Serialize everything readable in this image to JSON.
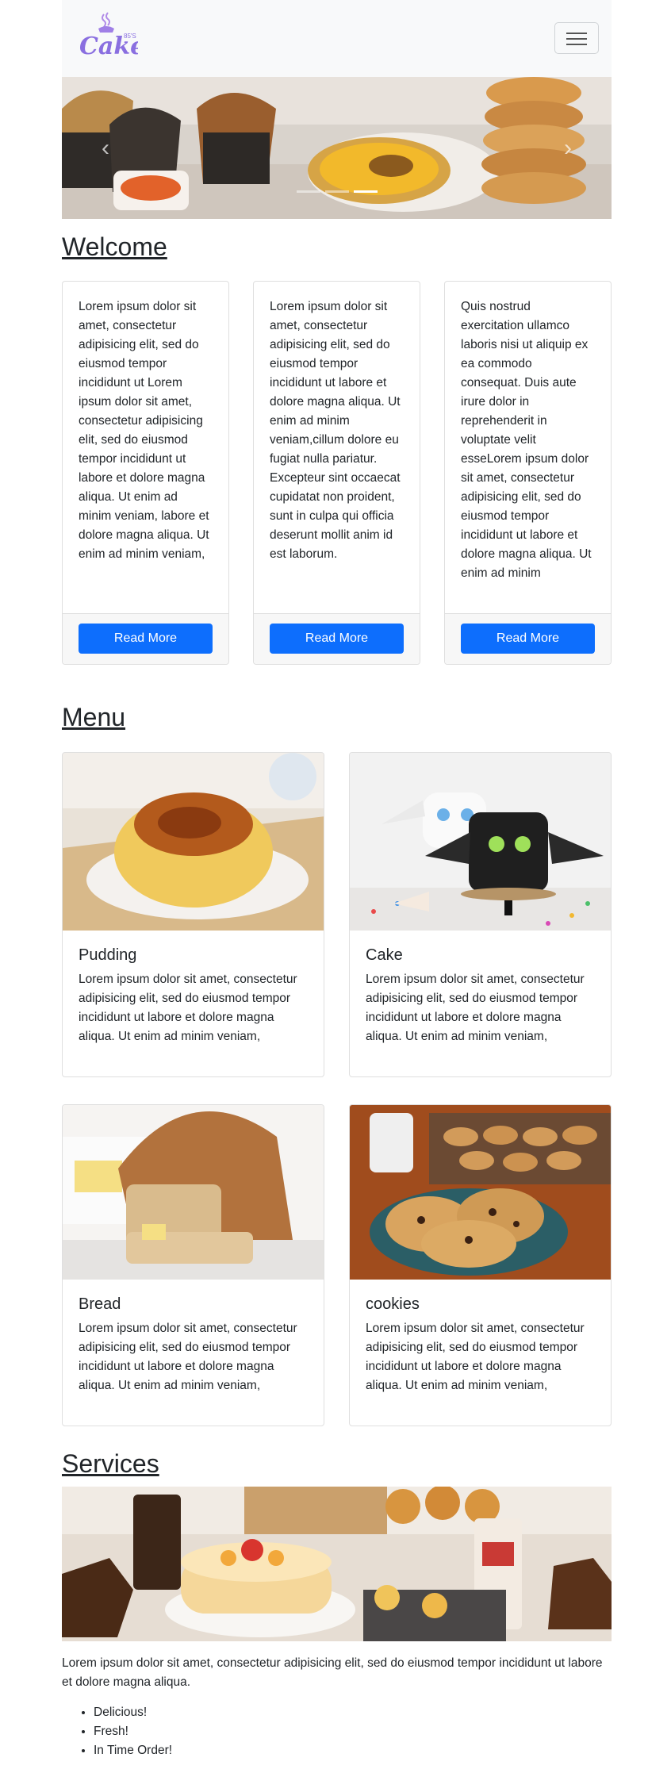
{
  "navbar": {
    "logo_text": "Cakes",
    "logo_superscript": "85'S",
    "toggler_icon": "hamburger-icon"
  },
  "carousel": {
    "prev_icon": "chevron-left-icon",
    "next_icon": "chevron-right-icon",
    "slides": 3,
    "active_slide": 3
  },
  "welcome": {
    "heading": "Welcome",
    "cards": [
      {
        "text": "Lorem ipsum dolor sit amet, consectetur adipisicing elit, sed do eiusmod tempor incididunt ut Lorem ipsum dolor sit amet, consectetur adipisicing elit, sed do eiusmod tempor incididunt ut labore et dolore magna aliqua. Ut enim ad minim veniam, labore et dolore magna aliqua. Ut enim ad minim veniam,",
        "button": "Read More"
      },
      {
        "text": "Lorem ipsum dolor sit amet, consectetur adipisicing elit, sed do eiusmod tempor incididunt ut labore et dolore magna aliqua. Ut enim ad minim veniam,cillum dolore eu fugiat nulla pariatur. Excepteur sint occaecat cupidatat non proident, sunt in culpa qui officia deserunt mollit anim id est laborum.",
        "button": "Read More"
      },
      {
        "text": "Quis nostrud exercitation ullamco laboris nisi ut aliquip ex ea commodo consequat. Duis aute irure dolor in reprehenderit in voluptate velit esseLorem ipsum dolor sit amet, consectetur adipisicing elit, sed do eiusmod tempor incididunt ut labore et dolore magna aliqua. Ut enim ad minim",
        "button": "Read More"
      }
    ]
  },
  "menu": {
    "heading": "Menu",
    "items": [
      {
        "title": "Pudding",
        "text": "Lorem ipsum dolor sit amet, consectetur adipisicing elit, sed do eiusmod tempor incididunt ut labore et dolore magna aliqua. Ut enim ad minim veniam,"
      },
      {
        "title": "Cake",
        "text": "Lorem ipsum dolor sit amet, consectetur adipisicing elit, sed do eiusmod tempor incididunt ut labore et dolore magna aliqua. Ut enim ad minim veniam,"
      },
      {
        "title": "Bread",
        "text": "Lorem ipsum dolor sit amet, consectetur adipisicing elit, sed do eiusmod tempor incididunt ut labore et dolore magna aliqua. Ut enim ad minim veniam,"
      },
      {
        "title": "cookies",
        "text": "Lorem ipsum dolor sit amet, consectetur adipisicing elit, sed do eiusmod tempor incididunt ut labore et dolore magna aliqua. Ut enim ad minim veniam,"
      }
    ]
  },
  "services": {
    "heading": "Services",
    "text": "Lorem ipsum dolor sit amet, consectetur adipisicing elit, sed do eiusmod tempor incididunt ut labore et dolore magna aliqua.",
    "list": [
      "Delicious!",
      "Fresh!",
      "In Time Order!"
    ]
  },
  "colors": {
    "primary": "#0d6efd",
    "navbar_bg": "#f8f9fa",
    "logo": "#8a6fe0"
  }
}
